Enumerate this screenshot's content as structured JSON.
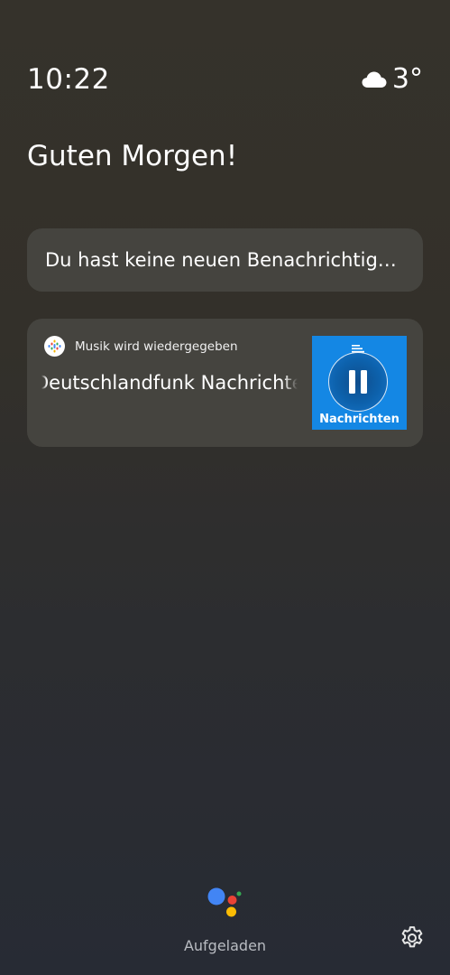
{
  "status": {
    "time": "10:22",
    "weather_icon": "cloud-icon",
    "temperature": "3°"
  },
  "greeting": "Guten Morgen!",
  "notification_card": {
    "text": "Du hast keine neuen Benachrichtigungen"
  },
  "media_card": {
    "app_icon": "podcast-app-icon",
    "status": "Musik wird wiedergegeben",
    "track_title": "Deutschlandfunk Nachrichten",
    "artwork": {
      "background_color": "#1487e4",
      "control_icon": "pause-icon",
      "label": "Nachrichten"
    }
  },
  "footer": {
    "assistant_icon": "google-assistant-icon",
    "charge_status": "Aufgeladen",
    "settings_icon": "gear-icon"
  },
  "colors": {
    "card_background": "#45443f",
    "assistant_blue": "#4285f4",
    "assistant_red": "#ea4335",
    "assistant_yellow": "#fbbc04",
    "assistant_green": "#34a853"
  }
}
